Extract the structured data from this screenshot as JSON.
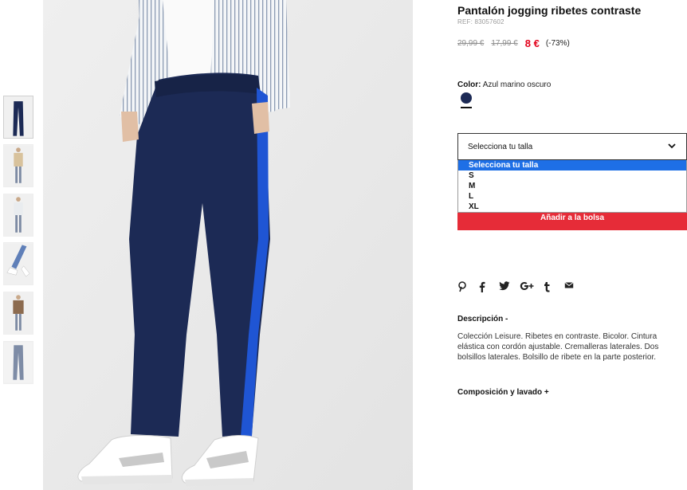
{
  "product": {
    "title": "Pantalón jogging ribetes contraste",
    "ref": "REF: 83057602",
    "prices": {
      "original": "29,99 €",
      "previous": "17,99 €",
      "current": "8 €",
      "discount": "(-73%)"
    }
  },
  "color": {
    "label": "Color:",
    "value": "Azul marino oscuro",
    "swatch_hex": "#1c2a55"
  },
  "size_select": {
    "current": "Selecciona tu talla",
    "options": [
      "Selecciona tu talla",
      "S",
      "M",
      "L",
      "XL"
    ],
    "highlighted_index": 0
  },
  "add_to_bag": "Añadir a la bolsa",
  "share_icons": [
    "pinterest-icon",
    "facebook-icon",
    "twitter-icon",
    "google-plus-icon",
    "tumblr-icon",
    "email-icon"
  ],
  "description": {
    "title": "Descripción -",
    "text": "Colección Leisure. Ribetes en contraste. Bicolor. Cintura elástica con cordón ajustable. Cremalleras laterales. Dos bolsillos laterales. Bolsillo de ribete en la parte posterior."
  },
  "composition": {
    "title": "Composición y lavado +"
  },
  "thumbnails": [
    "thumbnail-front-detail",
    "thumbnail-full-outfit-beige",
    "thumbnail-full-outfit-white",
    "thumbnail-shoes-detail",
    "thumbnail-outfit-jacket",
    "thumbnail-flat-lay"
  ],
  "colors": {
    "accent_red": "#e2001a",
    "button_red": "#e62c38",
    "highlight_blue": "#1e6fe6",
    "navy": "#1c2a55",
    "stripe_blue": "#1f55d4"
  }
}
